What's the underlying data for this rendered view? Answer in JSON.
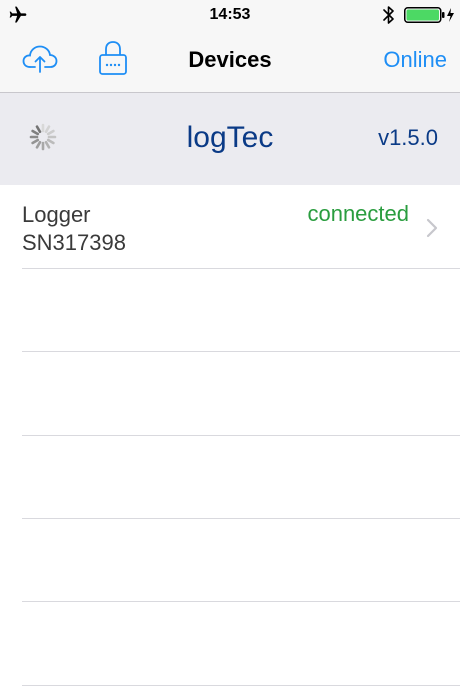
{
  "status_bar": {
    "time": "14:53",
    "airplane_icon": "airplane-icon",
    "bluetooth_icon": "bluetooth-icon",
    "battery_icon": "battery-icon",
    "battery_color": "#4cd964"
  },
  "nav": {
    "title": "Devices",
    "right_button": "Online",
    "left_icons": [
      "cloud-upload-icon",
      "lock-icon"
    ],
    "accent_color": "#1e8ef5"
  },
  "header": {
    "app_name": "logTec",
    "version": "v1.5.0",
    "spinner_icon": "spinner-icon",
    "text_color": "#0a3a86"
  },
  "devices": [
    {
      "name": "Logger",
      "serial": "SN317398",
      "status": "connected",
      "status_color": "#2a9d3f"
    }
  ]
}
